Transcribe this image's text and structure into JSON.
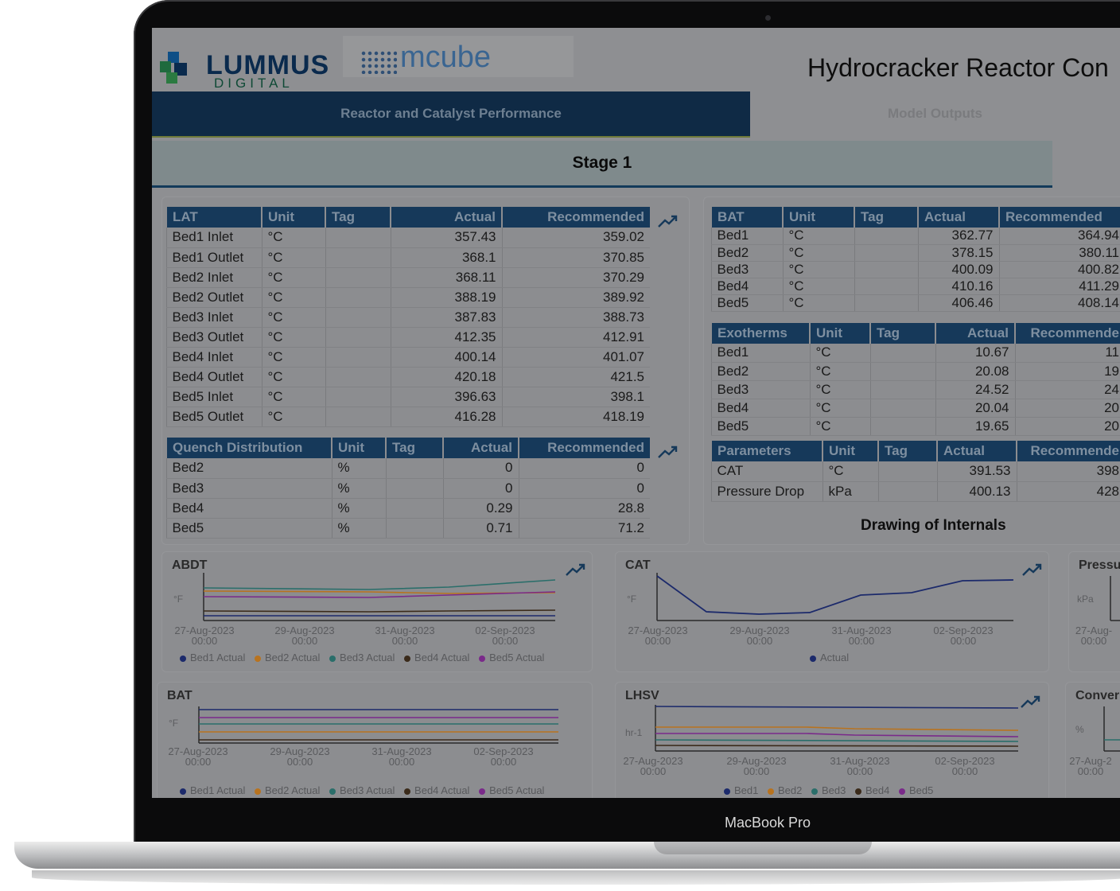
{
  "device": {
    "brand_label": "MacBook Pro"
  },
  "header": {
    "logo_text": "LUMMUS",
    "logo_sub": "DIGITAL",
    "product_logo": "mcube",
    "title": "Hydrocracker Reactor Con"
  },
  "tabs": [
    {
      "label": "Reactor and Catalyst Performance",
      "active": true
    },
    {
      "label": "Model Outputs",
      "active": false
    }
  ],
  "stage": {
    "label": "Stage 1"
  },
  "lat_table": {
    "headers": [
      "LAT",
      "Unit",
      "Tag",
      "Actual",
      "Recommended"
    ],
    "rows": [
      [
        "Bed1 Inlet",
        "°C",
        "",
        "357.43",
        "359.02"
      ],
      [
        "Bed1 Outlet",
        "°C",
        "",
        "368.1",
        "370.85"
      ],
      [
        "Bed2 Inlet",
        "°C",
        "",
        "368.11",
        "370.29"
      ],
      [
        "Bed2 Outlet",
        "°C",
        "",
        "388.19",
        "389.92"
      ],
      [
        "Bed3 Inlet",
        "°C",
        "",
        "387.83",
        "388.73"
      ],
      [
        "Bed3 Outlet",
        "°C",
        "",
        "412.35",
        "412.91"
      ],
      [
        "Bed4 Inlet",
        "°C",
        "",
        "400.14",
        "401.07"
      ],
      [
        "Bed4 Outlet",
        "°C",
        "",
        "420.18",
        "421.5"
      ],
      [
        "Bed5 Inlet",
        "°C",
        "",
        "396.63",
        "398.1"
      ],
      [
        "Bed5 Outlet",
        "°C",
        "",
        "416.28",
        "418.19"
      ]
    ]
  },
  "quench_table": {
    "headers": [
      "Quench Distribution",
      "Unit",
      "Tag",
      "Actual",
      "Recommended"
    ],
    "rows": [
      [
        "Bed2",
        "%",
        "",
        "0",
        "0"
      ],
      [
        "Bed3",
        "%",
        "",
        "0",
        "0"
      ],
      [
        "Bed4",
        "%",
        "",
        "0.29",
        "28.8"
      ],
      [
        "Bed5",
        "%",
        "",
        "0.71",
        "71.2"
      ]
    ]
  },
  "bat_table": {
    "headers": [
      "BAT",
      "Unit",
      "Tag",
      "Actual",
      "Recommended"
    ],
    "rows": [
      [
        "Bed1",
        "°C",
        "",
        "362.77",
        "364.94"
      ],
      [
        "Bed2",
        "°C",
        "",
        "378.15",
        "380.11"
      ],
      [
        "Bed3",
        "°C",
        "",
        "400.09",
        "400.82"
      ],
      [
        "Bed4",
        "°C",
        "",
        "410.16",
        "411.29"
      ],
      [
        "Bed5",
        "°C",
        "",
        "406.46",
        "408.14"
      ]
    ]
  },
  "exotherm_table": {
    "headers": [
      "Exotherms",
      "Unit",
      "Tag",
      "Actual",
      "Recommende"
    ],
    "rows": [
      [
        "Bed1",
        "°C",
        "",
        "10.67",
        "11"
      ],
      [
        "Bed2",
        "°C",
        "",
        "20.08",
        "19"
      ],
      [
        "Bed3",
        "°C",
        "",
        "24.52",
        "24"
      ],
      [
        "Bed4",
        "°C",
        "",
        "20.04",
        "20"
      ],
      [
        "Bed5",
        "°C",
        "",
        "19.65",
        "20"
      ]
    ]
  },
  "param_table": {
    "headers": [
      "Parameters",
      "Unit",
      "Tag",
      "Actual",
      "Recommende"
    ],
    "rows": [
      [
        "CAT",
        "°C",
        "",
        "391.53",
        "398"
      ],
      [
        "Pressure Drop",
        "kPa",
        "",
        "400.13",
        "428"
      ]
    ]
  },
  "drawing_label": "Drawing of Internals",
  "charts": {
    "abdt": {
      "title": "ABDT",
      "yunit": "°F",
      "ticks": [
        "27-Aug-2023",
        "29-Aug-2023",
        "31-Aug-2023",
        "02-Sep-2023"
      ],
      "tick_time": "00:00",
      "legend": [
        "Bed1 Actual",
        "Bed2 Actual",
        "Bed3 Actual",
        "Bed4 Actual",
        "Bed5 Actual"
      ]
    },
    "cat": {
      "title": "CAT",
      "yunit": "°F",
      "ticks": [
        "27-Aug-2023",
        "29-Aug-2023",
        "31-Aug-2023",
        "02-Sep-2023"
      ],
      "tick_time": "00:00",
      "legend": [
        "Actual"
      ]
    },
    "pressure": {
      "title": "Pressu",
      "yunit": "kPa",
      "ticks": [
        "27-Aug-"
      ],
      "tick_time": "00:00"
    },
    "bat": {
      "title": "BAT",
      "yunit": "°F",
      "ticks": [
        "27-Aug-2023",
        "29-Aug-2023",
        "31-Aug-2023",
        "02-Sep-2023"
      ],
      "tick_time": "00:00",
      "legend": [
        "Bed1 Actual",
        "Bed2 Actual",
        "Bed3 Actual",
        "Bed4 Actual",
        "Bed5 Actual"
      ]
    },
    "lhsv": {
      "title": "LHSV",
      "yunit": "hr-1",
      "ticks": [
        "27-Aug-2023",
        "29-Aug-2023",
        "31-Aug-2023",
        "02-Sep-2023"
      ],
      "tick_time": "00:00",
      "legend": [
        "Bed1",
        "Bed2",
        "Bed3",
        "Bed4",
        "Bed5"
      ]
    },
    "conversion": {
      "title": "Conver",
      "yunit": "%",
      "ticks": [
        "27-Aug-2"
      ],
      "tick_time": "00:00"
    }
  },
  "colors": {
    "bed1": "#1c2a6b",
    "bed2": "#b8731f",
    "bed3": "#2a6e6a",
    "bed4": "#3a2a1a",
    "bed5": "#7a2a8a",
    "header_fill": "#16395a",
    "accent": "#0f2a45"
  }
}
